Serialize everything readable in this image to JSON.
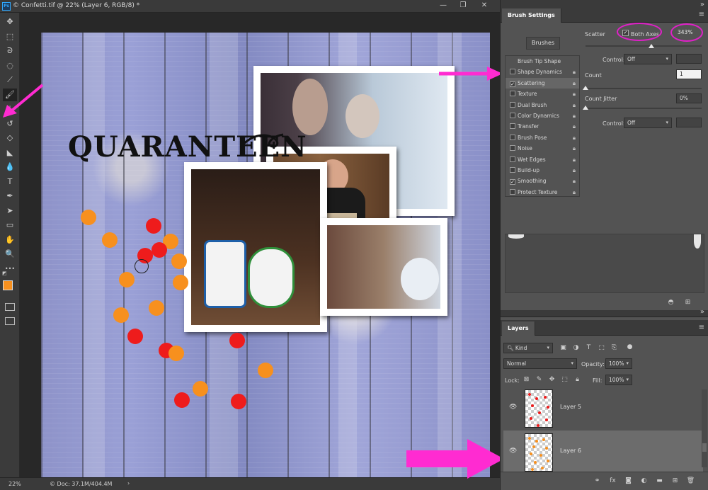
{
  "document": {
    "title": "© Confetti.tif @ 22% (Layer 6, RGB/8) *",
    "app_logo": "Ps",
    "zoom": "22%",
    "doc_info": "© Doc: 37.1M/404.4M",
    "canvas_heading": "QUARANTEEN",
    "window_minimize": "—",
    "window_restore": "❐",
    "window_close": "✕"
  },
  "tools": [
    {
      "icon": "move-icon",
      "glyph": "✥"
    },
    {
      "icon": "marquee-icon",
      "glyph": "⬚"
    },
    {
      "icon": "lasso-icon",
      "glyph": "ᘐ"
    },
    {
      "icon": "quick-select-icon",
      "glyph": "◌"
    },
    {
      "icon": "eyedropper-icon",
      "glyph": "⟋"
    },
    {
      "icon": "brush-icon",
      "glyph": "🖌"
    },
    {
      "icon": "stamp-icon",
      "glyph": "⊥"
    },
    {
      "icon": "history-brush-icon",
      "glyph": "↺"
    },
    {
      "icon": "eraser-icon",
      "glyph": "◇"
    },
    {
      "icon": "fill-icon",
      "glyph": "◣"
    },
    {
      "icon": "blur-icon",
      "glyph": "💧"
    },
    {
      "icon": "type-icon",
      "glyph": "T"
    },
    {
      "icon": "pen-icon",
      "glyph": "✒"
    },
    {
      "icon": "path-select-icon",
      "glyph": "➤"
    },
    {
      "icon": "rectangle-icon",
      "glyph": "▭"
    },
    {
      "icon": "hand-icon",
      "glyph": "✋"
    },
    {
      "icon": "zoom-icon",
      "glyph": "🔍"
    },
    {
      "icon": "more-icon",
      "glyph": "•••"
    }
  ],
  "colors": {
    "foreground": "#f7901e",
    "background": "#ffffff",
    "annotation": "#ff2bd1",
    "highlight_ring": "#e020c8",
    "dot_red": "#ee1c1c",
    "dot_orange": "#f7901e"
  },
  "brush_settings": {
    "tab_label": "Brush Settings",
    "brushes_button": "Brushes",
    "items": [
      {
        "label": "Brush Tip Shape",
        "checked": false,
        "has_checkbox": false
      },
      {
        "label": "Shape Dynamics",
        "checked": false,
        "has_checkbox": true
      },
      {
        "label": "Scattering",
        "checked": true,
        "has_checkbox": true
      },
      {
        "label": "Texture",
        "checked": false,
        "has_checkbox": true
      },
      {
        "label": "Dual Brush",
        "checked": false,
        "has_checkbox": true
      },
      {
        "label": "Color Dynamics",
        "checked": false,
        "has_checkbox": true
      },
      {
        "label": "Transfer",
        "checked": false,
        "has_checkbox": true
      },
      {
        "label": "Brush Pose",
        "checked": false,
        "has_checkbox": true
      },
      {
        "label": "Noise",
        "checked": false,
        "has_checkbox": true
      },
      {
        "label": "Wet Edges",
        "checked": false,
        "has_checkbox": true
      },
      {
        "label": "Build-up",
        "checked": false,
        "has_checkbox": true
      },
      {
        "label": "Smoothing",
        "checked": true,
        "has_checkbox": true
      },
      {
        "label": "Protect Texture",
        "checked": false,
        "has_checkbox": true
      }
    ],
    "scatter_label": "Scatter",
    "both_axes_label": "Both Axes",
    "scatter_value": "343%",
    "scatter_fraction": 0.57,
    "control_label": "Control:",
    "control_value": "Off",
    "count_label": "Count",
    "count_value": "1",
    "count_fraction": 0.0,
    "count_jitter_label": "Count Jitter",
    "count_jitter_value": "0%",
    "count_jitter_fraction": 0.0,
    "control2_label": "Control:",
    "control2_value": "Off"
  },
  "layers": {
    "tab_label": "Layers",
    "kind_label": "Kind",
    "blend_mode": "Normal",
    "opacity_label": "Opacity:",
    "opacity_value": "100%",
    "lock_label": "Lock:",
    "fill_label": "Fill:",
    "fill_value": "100%",
    "items": [
      {
        "name": "Layer 5",
        "selected": false
      },
      {
        "name": "Layer 6",
        "selected": true
      }
    ]
  }
}
